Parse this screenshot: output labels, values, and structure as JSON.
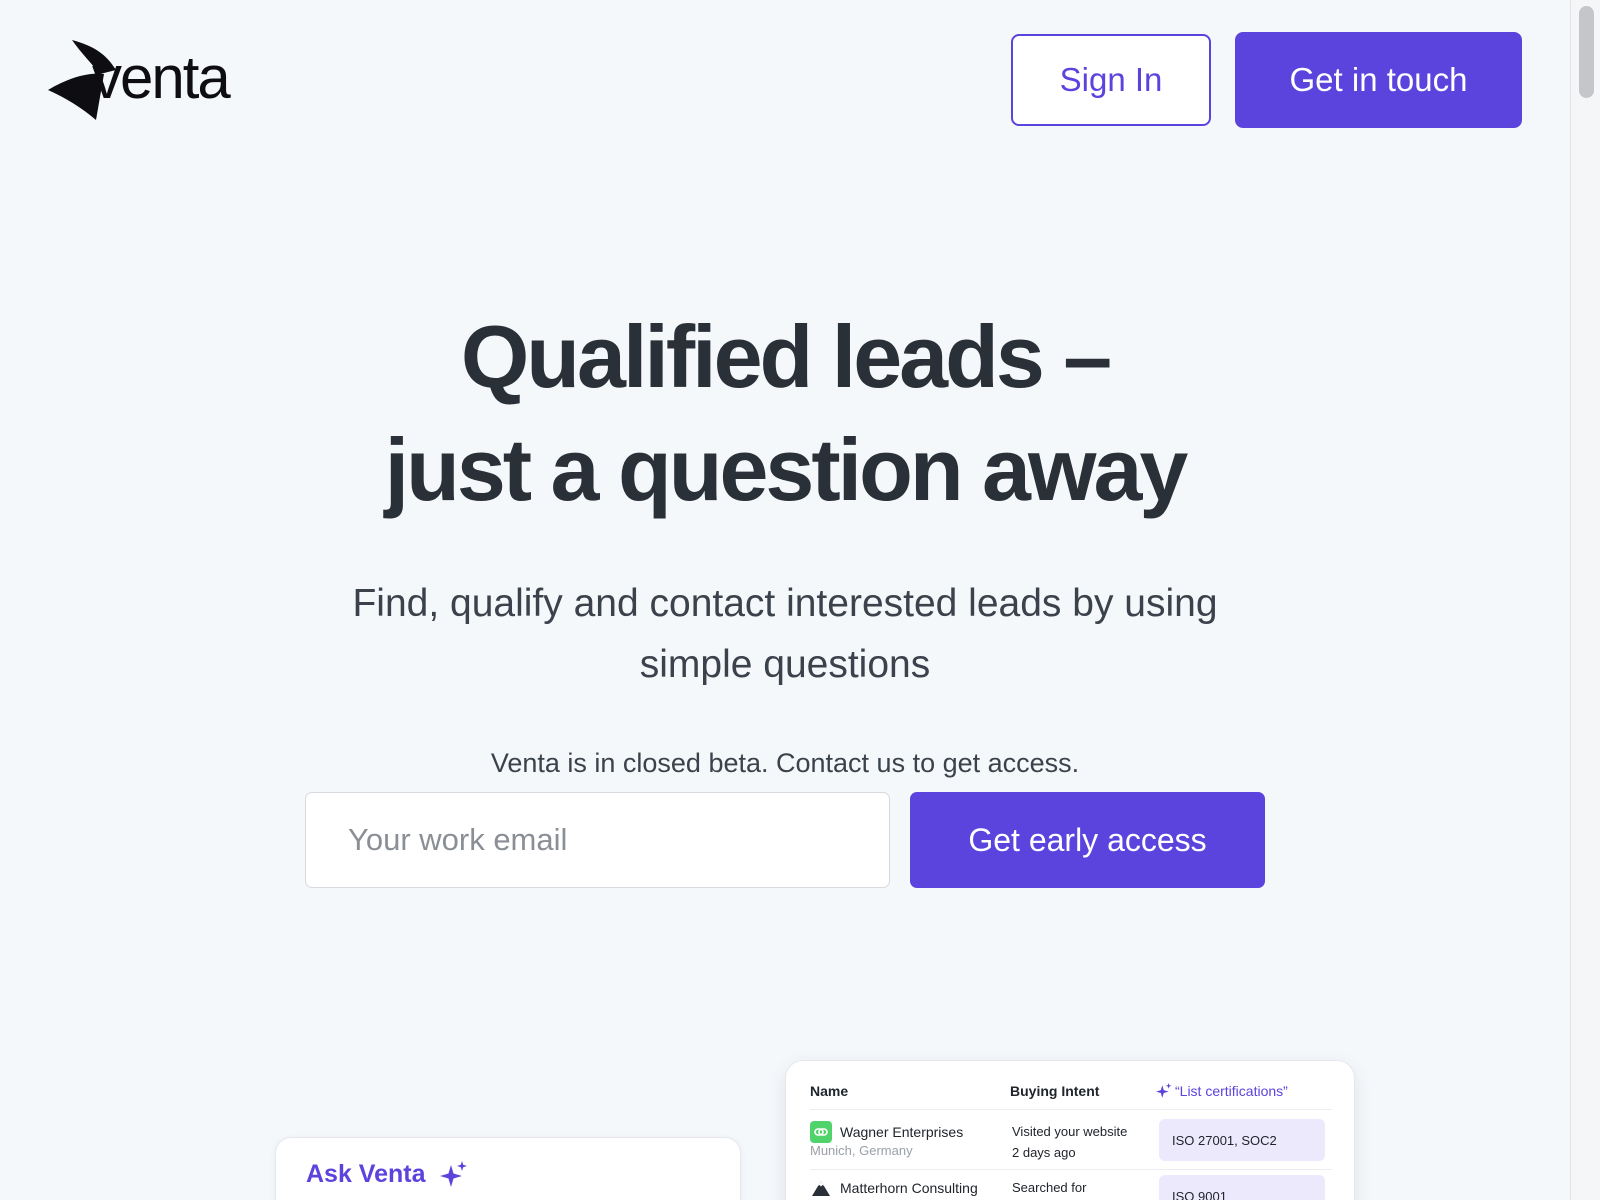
{
  "brand": {
    "name": "venta",
    "accent_color": "#5b43de"
  },
  "header": {
    "sign_in_label": "Sign In",
    "get_in_touch_label": "Get in touch"
  },
  "hero": {
    "title_line1": "Qualified leads –",
    "title_line2": "just a question away",
    "subtitle_line1": "Find, qualify and contact interested leads by using",
    "subtitle_line2": "simple questions",
    "beta_note": "Venta is in closed beta. Contact us to get access."
  },
  "signup": {
    "email_placeholder": "Your work email",
    "email_value": "",
    "submit_label": "Get early access"
  },
  "ask_card": {
    "title": "Ask Venta",
    "icon": "sparkle-icon"
  },
  "leads_table": {
    "columns": {
      "name": "Name",
      "intent": "Buying Intent",
      "ai_query": "“List certifications”"
    },
    "rows": [
      {
        "company": "Wagner Enterprises",
        "location": "Munich, Germany",
        "intent_line1": "Visited your website",
        "intent_line2": "2 days ago",
        "certifications": "ISO 27001, SOC2",
        "logo_icon": "link-icon"
      },
      {
        "company": "Matterhorn Consulting",
        "location": "",
        "intent_line1": "Searched for",
        "intent_line2": "",
        "certifications": "ISO 9001",
        "logo_icon": "mountain-icon"
      }
    ]
  }
}
